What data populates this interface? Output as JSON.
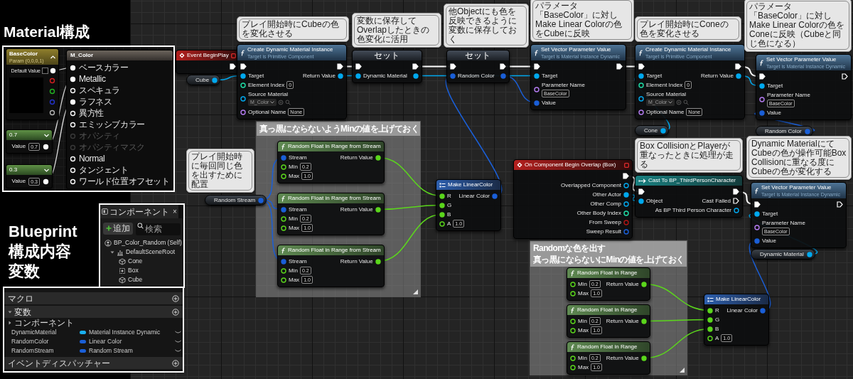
{
  "material": {
    "title": "Material構成",
    "nodes": [
      {
        "kind": "vector_param",
        "title": "BaseColor",
        "subtitle": "Param (0,0,0,1)",
        "default_label": "Default Value",
        "outputs": [
          {
            "color": "#ffffff",
            "connected": true
          },
          {
            "color": "#d42020",
            "connected": false
          },
          {
            "color": "#22b422",
            "connected": false
          },
          {
            "color": "#2233cc",
            "connected": false
          },
          {
            "color": "#b4b4b4",
            "connected": false
          }
        ]
      },
      {
        "kind": "scalar",
        "title": "0.7",
        "label": "Value",
        "value": "0.7",
        "outputs": [
          {
            "color": "#ffffff",
            "connected": true
          }
        ]
      },
      {
        "kind": "scalar",
        "title": "0.3",
        "label": "Value",
        "value": "0.3",
        "outputs": [
          {
            "color": "#ffffff",
            "connected": true
          }
        ]
      },
      {
        "kind": "material",
        "title": "M_Color",
        "inputs": [
          {
            "label": "ベースカラー",
            "connected": true,
            "disabled": false
          },
          {
            "label": "Metallic",
            "connected": true,
            "disabled": false
          },
          {
            "label": "スペキュラ",
            "connected": false,
            "disabled": false
          },
          {
            "label": "ラフネス",
            "connected": true,
            "disabled": false
          },
          {
            "label": "異方性",
            "connected": false,
            "disabled": false
          },
          {
            "label": "エミッシブカラー",
            "connected": false,
            "disabled": false
          },
          {
            "label": "オパシティ",
            "connected": false,
            "disabled": true
          },
          {
            "label": "オパシティマスク",
            "connected": false,
            "disabled": true
          },
          {
            "label": "Normal",
            "connected": false,
            "disabled": false
          },
          {
            "label": "タンジェント",
            "connected": false,
            "disabled": false
          },
          {
            "label": "ワールド位置オフセット",
            "connected": false,
            "disabled": false
          }
        ]
      }
    ]
  },
  "blueprint": {
    "title_lines": [
      "Blueprint",
      "構成内容",
      "変数"
    ],
    "components": {
      "tab": "コンポーネント",
      "close": "×",
      "add_label": "追加",
      "search_placeholder": "検索",
      "tree": [
        {
          "kind": "self",
          "label": "BP_Color_Random (Self)",
          "children": [
            {
              "kind": "scene",
              "label": "DefaultSceneRoot",
              "expanded": true,
              "children": [
                {
                  "kind": "mesh",
                  "label": "Cone"
                },
                {
                  "kind": "collision",
                  "label": "Box"
                },
                {
                  "kind": "mesh",
                  "label": "Cube"
                }
              ]
            }
          ]
        }
      ]
    },
    "my_blueprint": {
      "sections": [
        {
          "label": "マクロ"
        },
        {
          "label": "変数",
          "expanded": true,
          "categories": [
            {
              "label": "コンポーネント",
              "expanded": false
            }
          ],
          "variables": [
            {
              "name": "DynamicMaterial",
              "type": "Material Instance Dynamic",
              "color": "#1ab0f0"
            },
            {
              "name": "RandomColor",
              "type": "Linear Color",
              "color": "#1a5fd8"
            },
            {
              "name": "RandomStream",
              "type": "Random Stream",
              "color": "#1a5fd8"
            }
          ]
        },
        {
          "label": "イベントディスパッチャー"
        }
      ]
    }
  },
  "graph": {
    "comment_boxes": [
      {
        "title_lines": [
          "真っ黒にならないようMinの値を上げておく"
        ]
      },
      {
        "title_lines": [
          "Randomな色を出す",
          "真っ黒にならないにMinの値を上げておく"
        ]
      }
    ],
    "nodes": [
      {
        "kind": "event",
        "title": "Event BeginPlay",
        "rows": [
          {
            "right": {
              "kind": "exec",
              "connected": true
            }
          }
        ]
      },
      {
        "kind": "function",
        "title": "Create Dynamic Material Instance",
        "subtitle": "Target is Primitive Component",
        "comment": "プレイ開始時にCubeの色を変化させる",
        "rows": [
          {
            "left": {
              "kind": "exec",
              "connected": true
            },
            "right": {
              "kind": "exec",
              "connected": true
            }
          },
          {
            "left": {
              "kind": "object",
              "label": "Target",
              "connected": true
            },
            "right": {
              "kind": "object",
              "label": "Return Value",
              "connected": true
            }
          },
          {
            "left": {
              "kind": "int",
              "label": "Element Index",
              "value": "0",
              "connected": false
            }
          },
          {
            "left": {
              "kind": "object",
              "label": "Source Material",
              "value": "M_Color",
              "dropdown": true,
              "connected": false
            }
          },
          {
            "left": {
              "kind": "name",
              "label": "Optional Name",
              "value": "None",
              "connected": false
            }
          }
        ]
      },
      {
        "kind": "getter",
        "rows": [
          {
            "right": {
              "kind": "object",
              "label": "Cube",
              "connected": true
            }
          }
        ]
      },
      {
        "kind": "set",
        "title": "セット",
        "comment": "変数に保存してOverlapしたときの色変化に活用",
        "rows": [
          {
            "left": {
              "kind": "exec",
              "connected": true
            },
            "right": {
              "kind": "exec",
              "connected": true
            }
          },
          {
            "left": {
              "kind": "object",
              "label": "Dynamic Material",
              "connected": true
            },
            "right": {
              "kind": "object",
              "connected": true
            }
          }
        ]
      },
      {
        "kind": "set",
        "title": "セット",
        "comment": "他Objectにも色を反映できるように変数に保存しておく",
        "rows": [
          {
            "left": {
              "kind": "exec",
              "connected": true
            },
            "right": {
              "kind": "exec",
              "connected": true
            }
          },
          {
            "left": {
              "kind": "struct",
              "label": "Random Color",
              "connected": true
            },
            "right": {
              "kind": "struct",
              "connected": true
            }
          }
        ]
      },
      {
        "kind": "function",
        "title": "Set Vector Parameter Value",
        "subtitle": "Target is Material Instance Dynamic",
        "comment": "パラメータ「BaseColor」に対しMake Linear Colorの色をCubeに反映",
        "rows": [
          {
            "left": {
              "kind": "exec",
              "connected": true
            },
            "right": {
              "kind": "exec",
              "connected": true
            }
          },
          {
            "left": {
              "kind": "object",
              "label": "Target",
              "connected": true
            }
          },
          {
            "left": {
              "kind": "name",
              "label": "Parameter Name",
              "value": "BaseColor",
              "stacked": true,
              "connected": false
            }
          },
          {
            "left": {
              "kind": "struct",
              "label": "Value",
              "connected": true
            }
          }
        ]
      },
      {
        "kind": "function",
        "title": "Create Dynamic Material Instance",
        "subtitle": "Target is Primitive Component",
        "comment": "プレイ開始時にConeの色を変化させる",
        "rows": [
          {
            "left": {
              "kind": "exec",
              "connected": true
            },
            "right": {
              "kind": "exec",
              "connected": true
            }
          },
          {
            "left": {
              "kind": "object",
              "label": "Target",
              "connected": true
            },
            "right": {
              "kind": "object",
              "label": "Return Value",
              "connected": true
            }
          },
          {
            "left": {
              "kind": "int",
              "label": "Element Index",
              "value": "0",
              "connected": false
            }
          },
          {
            "left": {
              "kind": "object",
              "label": "Source Material",
              "value": "M_Color",
              "dropdown": true,
              "connected": false
            }
          },
          {
            "left": {
              "kind": "name",
              "label": "Optional Name",
              "value": "None",
              "connected": false
            }
          }
        ]
      },
      {
        "kind": "getter",
        "rows": [
          {
            "right": {
              "kind": "object",
              "label": "Cone",
              "connected": true
            }
          }
        ]
      },
      {
        "kind": "function",
        "title": "Set Vector Parameter Value",
        "subtitle": "Target is Material Instance Dynamic",
        "comment": "パラメータ「BaseColor」に対しMake Linear Colorの色をConeに反映（Cubeと同じ色になる）",
        "rows": [
          {
            "left": {
              "kind": "exec",
              "connected": true
            },
            "right": {
              "kind": "exec",
              "connected": false
            }
          },
          {
            "left": {
              "kind": "object",
              "label": "Target",
              "connected": true
            }
          },
          {
            "left": {
              "kind": "name",
              "label": "Parameter Name",
              "value": "BaseColor",
              "stacked": true,
              "connected": false
            }
          },
          {
            "left": {
              "kind": "struct",
              "label": "Value",
              "connected": true
            }
          }
        ]
      },
      {
        "kind": "getter",
        "rows": [
          {
            "right": {
              "kind": "struct",
              "label": "Random Color",
              "connected": true
            }
          }
        ]
      },
      {
        "kind": "getter",
        "comment": "プレイ開始時に毎回同じ色を出すために配置",
        "rows": [
          {
            "right": {
              "kind": "struct",
              "label": "Random Stream",
              "connected": true
            }
          }
        ]
      },
      {
        "kind": "random",
        "title": "Random Float in Range from Stream",
        "rows": [
          {
            "left": {
              "kind": "struct",
              "label": "Stream",
              "connected": true
            },
            "right": {
              "kind": "float",
              "label": "Return Value",
              "connected": true
            }
          },
          {
            "left": {
              "kind": "float",
              "label": "Min",
              "value": "0.2",
              "connected": false
            }
          },
          {
            "left": {
              "kind": "float",
              "label": "Max",
              "value": "1.0",
              "connected": false
            }
          }
        ]
      },
      {
        "kind": "random",
        "title": "Random Float in Range from Stream",
        "rows": [
          {
            "left": {
              "kind": "struct",
              "label": "Stream",
              "connected": true
            },
            "right": {
              "kind": "float",
              "label": "Return Value",
              "connected": true
            }
          },
          {
            "left": {
              "kind": "float",
              "label": "Min",
              "value": "0.2",
              "connected": false
            }
          },
          {
            "left": {
              "kind": "float",
              "label": "Max",
              "value": "1.0",
              "connected": false
            }
          }
        ]
      },
      {
        "kind": "random",
        "title": "Random Float in Range from Stream",
        "rows": [
          {
            "left": {
              "kind": "struct",
              "label": "Stream",
              "connected": true
            },
            "right": {
              "kind": "float",
              "label": "Return Value",
              "connected": true
            }
          },
          {
            "left": {
              "kind": "float",
              "label": "Min",
              "value": "0.2",
              "connected": false
            }
          },
          {
            "left": {
              "kind": "float",
              "label": "Max",
              "value": "1.0",
              "connected": false
            }
          }
        ]
      },
      {
        "kind": "pure",
        "title": "Make LinearColor",
        "rows": [
          {
            "left": {
              "kind": "float",
              "label": "R",
              "connected": true
            },
            "right": {
              "kind": "struct",
              "label": "Linear Color",
              "connected": true
            }
          },
          {
            "left": {
              "kind": "float",
              "label": "G",
              "connected": true
            }
          },
          {
            "left": {
              "kind": "float",
              "label": "B",
              "connected": true
            }
          },
          {
            "left": {
              "kind": "float",
              "label": "A",
              "value": "1.0",
              "connected": false
            }
          }
        ]
      },
      {
        "kind": "event",
        "title": "On Component Begin Overlap (Box)",
        "rows": [
          {
            "right": {
              "kind": "exec",
              "connected": true
            }
          },
          {
            "right": {
              "kind": "object",
              "label": "Overlapped Component",
              "connected": false
            }
          },
          {
            "right": {
              "kind": "object",
              "label": "Other Actor",
              "connected": true
            }
          },
          {
            "right": {
              "kind": "object",
              "label": "Other Comp",
              "connected": false
            }
          },
          {
            "right": {
              "kind": "int",
              "label": "Other Body Index",
              "connected": false
            }
          },
          {
            "right": {
              "kind": "bool",
              "label": "From Sweep",
              "connected": false
            }
          },
          {
            "right": {
              "kind": "struct",
              "label": "Sweep Result",
              "connected": false
            }
          }
        ]
      },
      {
        "kind": "cast",
        "title": "Cast To BP_ThirdPersonCharacter",
        "comment": "Box CollisionとPlayerが重なったときに処理が走る",
        "rows": [
          {
            "left": {
              "kind": "exec",
              "connected": true
            },
            "right": {
              "kind": "exec",
              "connected": true
            }
          },
          {
            "left": {
              "kind": "object",
              "label": "Object",
              "connected": true
            },
            "right": {
              "kind": "exec",
              "label": "Cast Failed",
              "connected": false
            }
          },
          {
            "right": {
              "kind": "object",
              "label": "As BP Third Person Character",
              "connected": false
            }
          }
        ]
      },
      {
        "kind": "function",
        "title": "Set Vector Parameter Value",
        "subtitle": "Target is Material Instance Dynamic",
        "comment": "Dynamic MaterialにてCubeの色が操作可能Box Collisionに重なる度にCubeの色が変化する",
        "rows": [
          {
            "left": {
              "kind": "exec",
              "connected": true
            },
            "right": {
              "kind": "exec",
              "connected": false
            }
          },
          {
            "left": {
              "kind": "object",
              "label": "Target",
              "connected": true
            }
          },
          {
            "left": {
              "kind": "name",
              "label": "Parameter Name",
              "value": "BaseColor",
              "stacked": true,
              "connected": false
            }
          },
          {
            "left": {
              "kind": "struct",
              "label": "Value",
              "connected": true
            }
          }
        ]
      },
      {
        "kind": "getter",
        "rows": [
          {
            "right": {
              "kind": "object",
              "label": "Dynamic Material",
              "connected": true
            }
          }
        ]
      },
      {
        "kind": "random",
        "title": "Random Float in Range",
        "rows": [
          {
            "left": {
              "kind": "float",
              "label": "Min",
              "value": "0.2",
              "connected": false
            },
            "right": {
              "kind": "float",
              "label": "Return Value",
              "connected": true
            }
          },
          {
            "left": {
              "kind": "float",
              "label": "Max",
              "value": "1.0",
              "connected": false
            }
          }
        ]
      },
      {
        "kind": "random",
        "title": "Random Float in Range",
        "rows": [
          {
            "left": {
              "kind": "float",
              "label": "Min",
              "value": "0.2",
              "connected": false
            },
            "right": {
              "kind": "float",
              "label": "Return Value",
              "connected": true
            }
          },
          {
            "left": {
              "kind": "float",
              "label": "Max",
              "value": "1.0",
              "connected": false
            }
          }
        ]
      },
      {
        "kind": "random",
        "title": "Random Float in Range",
        "rows": [
          {
            "left": {
              "kind": "float",
              "label": "Min",
              "value": "0.2",
              "connected": false
            },
            "right": {
              "kind": "float",
              "label": "Return Value",
              "connected": true
            }
          },
          {
            "left": {
              "kind": "float",
              "label": "Max",
              "value": "1.0",
              "connected": false
            }
          }
        ]
      },
      {
        "kind": "pure",
        "title": "Make LinearColor",
        "rows": [
          {
            "left": {
              "kind": "float",
              "label": "R",
              "connected": true
            },
            "right": {
              "kind": "struct",
              "label": "Linear Color",
              "connected": true
            }
          },
          {
            "left": {
              "kind": "float",
              "label": "G",
              "connected": true
            }
          },
          {
            "left": {
              "kind": "float",
              "label": "B",
              "connected": true
            }
          },
          {
            "left": {
              "kind": "float",
              "label": "A",
              "value": "1.0",
              "connected": false
            }
          }
        ]
      }
    ]
  }
}
